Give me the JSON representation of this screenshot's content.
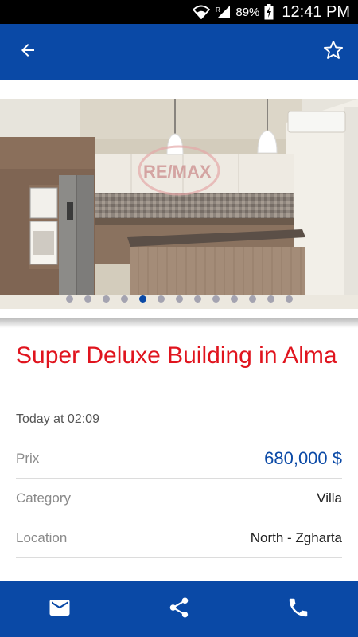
{
  "status_bar": {
    "battery_percent": "89%",
    "time": "12:41 PM",
    "icons": [
      "wifi-icon",
      "signal-icon",
      "battery-charging-icon"
    ]
  },
  "app_bar": {
    "icons": [
      "arrow-back-icon",
      "star-outline-icon"
    ]
  },
  "gallery": {
    "photo_count": 13,
    "active_index": 4,
    "watermark_text": "RE/MAX"
  },
  "listing": {
    "title": "Super Deluxe Building in Alma",
    "date": "Today at 02:09",
    "details": [
      {
        "label": "Prix",
        "value": "680,000 $"
      },
      {
        "label": "Category",
        "value": "Villa"
      },
      {
        "label": "Location",
        "value": "North - Zgharta"
      }
    ]
  },
  "bottom_bar": {
    "icons": [
      "email-icon",
      "share-icon",
      "phone-icon"
    ]
  },
  "colors": {
    "primary_blue": "#0a49a6",
    "title_red": "#e0141e",
    "price_blue": "#0a49a6"
  }
}
